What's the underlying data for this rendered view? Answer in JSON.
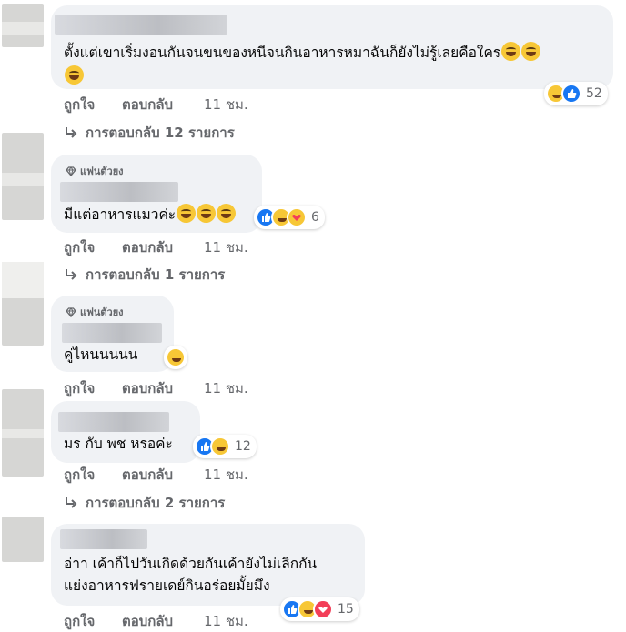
{
  "comments": [
    {
      "text_lines": [
        "ตั้งแต่เขาเริ่มงอนกันจนขนของหนีจนกินอาหารหมาฉันก็ยังไม่รู้เลยคือใคร"
      ],
      "reactions_count": "52",
      "reaction_icons": [
        "haha",
        "like"
      ]
    },
    {
      "badge": "แฟนตัวยง",
      "text_lines": [
        "มีแต่อาหารแมวค่ะ"
      ],
      "reactions_count": "6",
      "reaction_icons": [
        "like",
        "haha",
        "care"
      ]
    },
    {
      "badge": "แฟนตัวยง",
      "text_lines": [
        "คู่ไหนนนนน"
      ],
      "reactions_count": "",
      "reaction_icons": [
        "haha"
      ]
    },
    {
      "text_lines": [
        "มร กับ พช หรอค่ะ"
      ],
      "reactions_count": "12",
      "reaction_icons": [
        "like",
        "haha"
      ]
    },
    {
      "text_lines": [
        "อ่าา เค้าก็ไปวันเกิดด้วยกันเค้ายังไม่เลิกกัน",
        "แย่งอาหารฟรายเดย์กินอร่อยมั้ยมึง"
      ],
      "reactions_count": "15",
      "reaction_icons": [
        "like",
        "haha",
        "love"
      ]
    }
  ],
  "actions": {
    "like": "ถูกใจ",
    "reply": "ตอบกลับ",
    "time": "11 ชม."
  },
  "replies": [
    "การตอบกลับ 12 รายการ",
    "การตอบกลับ 1 รายการ",
    "การตอบกลับ 2 รายการ"
  ],
  "icons": {
    "reply_arrow": "reply-arrow-icon",
    "badge": "diamond-icon",
    "emoji": "laughing-emoji-icon"
  },
  "colors": {
    "bubble": "#f0f2f5",
    "meta": "#65676b",
    "like": "#1877f2",
    "love": "#f33e58",
    "haha": "#f7c736"
  }
}
